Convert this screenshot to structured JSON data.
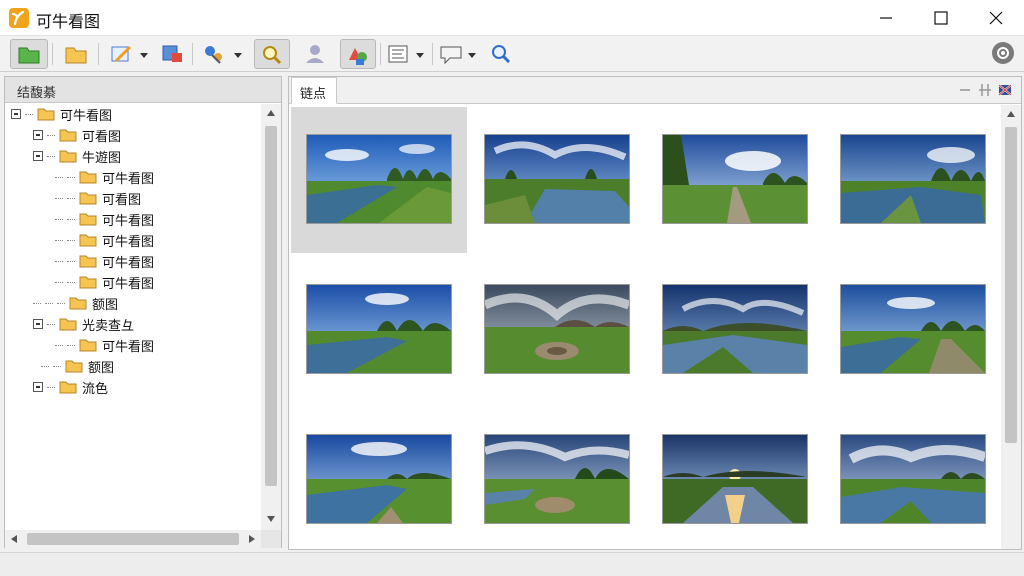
{
  "app": {
    "title": "可牛看图"
  },
  "window": {
    "minimize_icon": "minimize-icon",
    "maximize_icon": "maximize-icon",
    "close_icon": "close-icon"
  },
  "toolbar": {
    "buttons": [
      {
        "name": "open-folder-button",
        "icon": "green-folder-icon",
        "pressed": true
      },
      {
        "name": "folder-button",
        "icon": "folder-icon",
        "pressed": false
      },
      {
        "name": "edit-button",
        "icon": "pencil-icon",
        "pressed": false,
        "dropdown": true
      },
      {
        "name": "export-button",
        "icon": "export-icon",
        "pressed": false
      },
      {
        "name": "effects-button",
        "icon": "effects-icon",
        "pressed": false,
        "dropdown": true
      },
      {
        "name": "zoom-button",
        "icon": "magnifier-icon",
        "pressed": true
      },
      {
        "name": "user-button",
        "icon": "user-icon",
        "pressed": false
      },
      {
        "name": "shapes-button",
        "icon": "shapes-icon",
        "pressed": true
      },
      {
        "name": "view-button",
        "icon": "list-view-icon",
        "pressed": false,
        "dropdown": true
      },
      {
        "name": "comment-button",
        "icon": "speech-bubble-icon",
        "pressed": false,
        "dropdown": true
      },
      {
        "name": "search-button",
        "icon": "search-icon",
        "pressed": false
      }
    ],
    "right_icon": "settings-icon"
  },
  "left_panel": {
    "header": "结馥綦",
    "tree": [
      {
        "label": "可牛看图",
        "level": 0,
        "expander": true
      },
      {
        "label": "可看图",
        "level": 1,
        "expander": true
      },
      {
        "label": "牛遊图",
        "level": 1,
        "expander": true
      },
      {
        "label": "可牛看图",
        "level": 2,
        "expander": false
      },
      {
        "label": "可看图",
        "level": 2,
        "expander": false
      },
      {
        "label": "可牛看图",
        "level": 2,
        "expander": false
      },
      {
        "label": "可牛看图",
        "level": 2,
        "expander": false
      },
      {
        "label": "可牛看图",
        "level": 2,
        "expander": false
      },
      {
        "label": "可牛看图",
        "level": 2,
        "expander": false
      },
      {
        "label": "额图",
        "level": 2,
        "expander": false
      },
      {
        "label": "光卖查彑",
        "level": 1,
        "expander": true
      },
      {
        "label": "可牛看图",
        "level": 2,
        "expander": false
      },
      {
        "label": "额图",
        "level": 1,
        "expander": false
      },
      {
        "label": "流色",
        "level": 1,
        "expander": true
      }
    ]
  },
  "right_panel": {
    "tab_label": "链点",
    "tab_controls": [
      "collapse-icon",
      "split-icon",
      "flag-icon"
    ],
    "thumbnails": [
      {
        "name": "river-meadow-trees",
        "selected": true
      },
      {
        "name": "river-clouds-trees",
        "selected": false
      },
      {
        "name": "path-trees-clouds",
        "selected": false
      },
      {
        "name": "river-bank-trees",
        "selected": false
      },
      {
        "name": "river-blue-sky",
        "selected": false
      },
      {
        "name": "rock-field-clouds",
        "selected": false
      },
      {
        "name": "river-reflection-dusk",
        "selected": false
      },
      {
        "name": "river-path-meadow",
        "selected": false
      },
      {
        "name": "river-meadow-wide",
        "selected": false
      },
      {
        "name": "pond-field-trees",
        "selected": false
      },
      {
        "name": "sunset-river",
        "selected": false
      },
      {
        "name": "river-clouds-evening",
        "selected": false
      }
    ]
  }
}
